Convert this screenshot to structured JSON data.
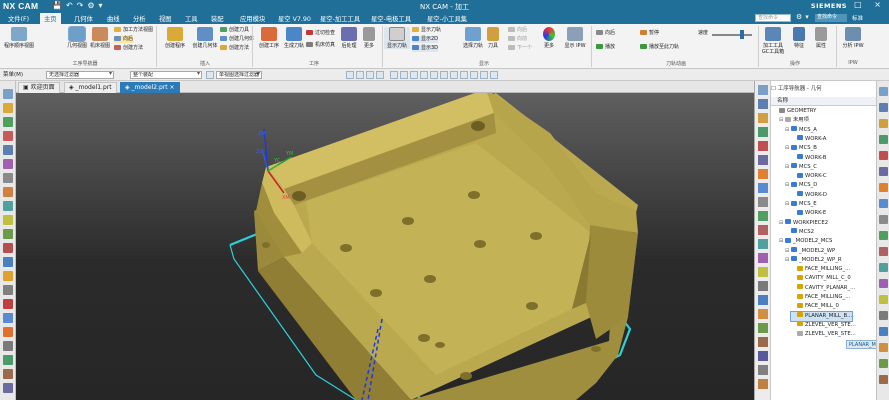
{
  "app": {
    "logo": "NX CAM",
    "window_title": "NX CAM - 加工",
    "brand": "SIEMENS",
    "win_buttons": "– □ ×"
  },
  "menu": {
    "tabs": [
      "文件(F)",
      "主页",
      "几何体",
      "曲线",
      "分析",
      "视图",
      "工具",
      "装配",
      "应用模块",
      "星空 V7.90",
      "星空-加工工具",
      "星空-电极工具",
      "星空-小工具集"
    ],
    "active_tab": "主页",
    "search_placeholder": "查找命令",
    "command_finder": "查找命令",
    "help": "标准"
  },
  "ribbon": {
    "groups": [
      {
        "label": "工序导航器"
      },
      {
        "label": "插入"
      },
      {
        "label": "工序"
      },
      {
        "label": "显示"
      },
      {
        "label": "刀轨动画"
      },
      {
        "label": "操作"
      },
      {
        "label": "IPW"
      }
    ],
    "buttons": {
      "program_order": "程序顺序视图",
      "geometry_view": "几何视图",
      "machine_view": "机床视图",
      "create_program": "创建程序",
      "create_geometry": "创建几何体",
      "create_method_list": "创建刀具",
      "create_geom_list": "创建几何体",
      "create_method": "创建方法",
      "create_operation": "创建工序",
      "generate": "生成刀轨",
      "confirm": "确认刀轨",
      "tool_check": "过切检查",
      "machine_sim": "机床仿真",
      "post": "后处理",
      "more": "更多",
      "show_tool": "显示刀轨",
      "show_2d": "显示2D",
      "show_3d": "显示3D",
      "select_tool": "选择刀轨",
      "tool": "刀具",
      "shop_doc": "车间文档",
      "color": "更多",
      "show_ipw": "显示 IPW",
      "play": "播放",
      "pause": "暂停",
      "stop": "停止",
      "speed": "速度",
      "mach_tool": "加工工具GC工具箱",
      "feature": "特征",
      "property": "属性",
      "analyze_ipw": "分析 IPW",
      "method_view": "加工方法视图",
      "step_back": "向后",
      "step_fwd": "向前",
      "show_path_1": "显示刀轨",
      "show_path_2": "显示刀轨",
      "show_path_3": "显示刀轨",
      "next_op": "下一个",
      "play_to_end": "播放至此刀轨",
      "reverse": "反向播放"
    }
  },
  "filterbar": {
    "menu_label": "菜单(M)",
    "filter_combo": "无选择过滤器",
    "assembly_combo": "整个装配",
    "view_combo": "单视图选择过滤器"
  },
  "doctabs": [
    {
      "label": "欢迎页面"
    },
    {
      "label": "_model1.prt"
    },
    {
      "label": "_model2.prt"
    }
  ],
  "active_doc": "_model2.prt",
  "viewport": {
    "axis_labels": {
      "zm": "ZM",
      "ym": "YM",
      "xm": "XM",
      "zc": "ZC",
      "yc": "YC",
      "xc": "XC"
    },
    "colors": {
      "part_top": "#c9b55a",
      "part_side": "#a9963f",
      "part_dark": "#8c7a30",
      "toolpath": "#2cd0d6",
      "axis_blue": "#1d3adb",
      "axis_red": "#cc2020",
      "axis_green": "#20a030"
    }
  },
  "navigator": {
    "title": "工序导航器 - 几何",
    "column": "名称",
    "nodes": [
      {
        "label": "GEOMETRY",
        "depth": 0,
        "exp": "",
        "icon": "#888"
      },
      {
        "label": "未用项",
        "depth": 1,
        "exp": "⊟",
        "icon": "#aaa"
      },
      {
        "label": "MCS_A",
        "depth": 2,
        "exp": "⊟",
        "icon": "#3a7bd5"
      },
      {
        "label": "WORK-A",
        "depth": 3,
        "exp": "",
        "icon": "#3a7bd5"
      },
      {
        "label": "MCS_B",
        "depth": 2,
        "exp": "⊟",
        "icon": "#3a7bd5"
      },
      {
        "label": "WORK-B",
        "depth": 3,
        "exp": "",
        "icon": "#3a7bd5"
      },
      {
        "label": "MCS_C",
        "depth": 2,
        "exp": "⊟",
        "icon": "#3a7bd5"
      },
      {
        "label": "WORK-C",
        "depth": 3,
        "exp": "",
        "icon": "#3a7bd5"
      },
      {
        "label": "MCS_D",
        "depth": 2,
        "exp": "⊟",
        "icon": "#3a7bd5"
      },
      {
        "label": "WORK-D",
        "depth": 3,
        "exp": "",
        "icon": "#3a7bd5"
      },
      {
        "label": "MCS_E",
        "depth": 2,
        "exp": "⊟",
        "icon": "#3a7bd5"
      },
      {
        "label": "WORK-E",
        "depth": 3,
        "exp": "",
        "icon": "#3a7bd5"
      },
      {
        "label": "WORKPIECE2",
        "depth": 1,
        "exp": "⊟",
        "icon": "#3a7bd5"
      },
      {
        "label": "MCS2",
        "depth": 2,
        "exp": "",
        "icon": "#3a7bd5"
      },
      {
        "label": "_MODEL2_MCS",
        "depth": 1,
        "exp": "⊟",
        "icon": "#3a7bd5"
      },
      {
        "label": "_MODEL2_WP",
        "depth": 2,
        "exp": "⊟",
        "icon": "#3a7bd5"
      },
      {
        "label": "_MODEL2_WP_R",
        "depth": 2,
        "exp": "⊟",
        "icon": "#3a7bd5"
      },
      {
        "label": "FACE_MILLING_...",
        "depth": 3,
        "exp": "",
        "icon": "#d9a400"
      },
      {
        "label": "CAVITY_MILL_C_0",
        "depth": 3,
        "exp": "",
        "icon": "#d9a400"
      },
      {
        "label": "CAVITY_PLANAR_...",
        "depth": 3,
        "exp": "",
        "icon": "#d9a400"
      },
      {
        "label": "FACE_MILLING_...",
        "depth": 3,
        "exp": "",
        "icon": "#d9a400"
      },
      {
        "label": "FACE_MILL_0",
        "depth": 3,
        "exp": "",
        "icon": "#d9a400"
      },
      {
        "label": "PLANAR_MILL_B...",
        "depth": 3,
        "exp": "",
        "icon": "#d9a400",
        "selected": true
      },
      {
        "label": "ZLEVEL_VER_STE...",
        "depth": 3,
        "exp": "",
        "icon": "#d9a400"
      },
      {
        "label": "ZLEVEL_VER_STE...",
        "depth": 3,
        "exp": "",
        "icon": "#aaa"
      }
    ],
    "tooltip": "PLANAR_MILL_B"
  }
}
